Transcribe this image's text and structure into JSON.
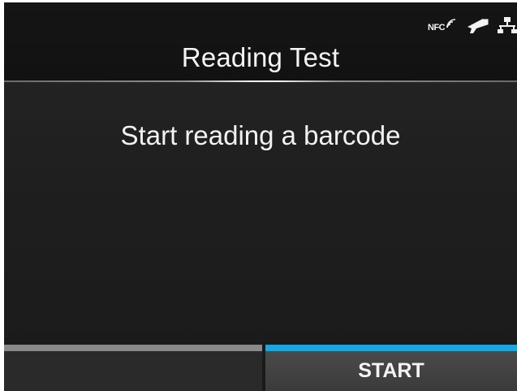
{
  "header": {
    "title": "Reading Test",
    "status_icons": [
      {
        "name": "nfc-icon",
        "label": "NFC"
      },
      {
        "name": "barcode-scanner-icon"
      },
      {
        "name": "network-icon"
      }
    ]
  },
  "main": {
    "message": "Start reading a barcode"
  },
  "softkeys": {
    "left_label": "",
    "right_label": "START"
  },
  "colors": {
    "accent": "#13a8e6",
    "background": "#1f1f1f",
    "text": "#f4f4f4"
  }
}
